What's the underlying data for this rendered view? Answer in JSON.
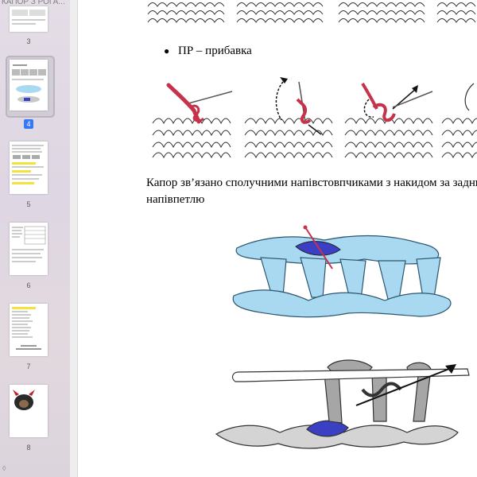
{
  "sidebar": {
    "title": "КАПОР З РОГА...",
    "pages": [
      {
        "number": "3"
      },
      {
        "number": "4",
        "selected": true
      },
      {
        "number": "5"
      },
      {
        "number": "6"
      },
      {
        "number": "7"
      },
      {
        "number": "8"
      }
    ],
    "bottom_control": "◊"
  },
  "document": {
    "bullet_label": "ПР – прибавка",
    "paragraph_line1": "Капор зв’язано сполучними напівстовпчиками з накидом за задню",
    "paragraph_line2": "напівпетлю"
  },
  "colors": {
    "yarn_light_blue": "#a9d8f1",
    "yarn_dark_blue": "#3b3fc4",
    "yarn_grey": "#a6a6a6",
    "yarn_red": "#c6324a",
    "selection_badge": "#3478f6"
  }
}
